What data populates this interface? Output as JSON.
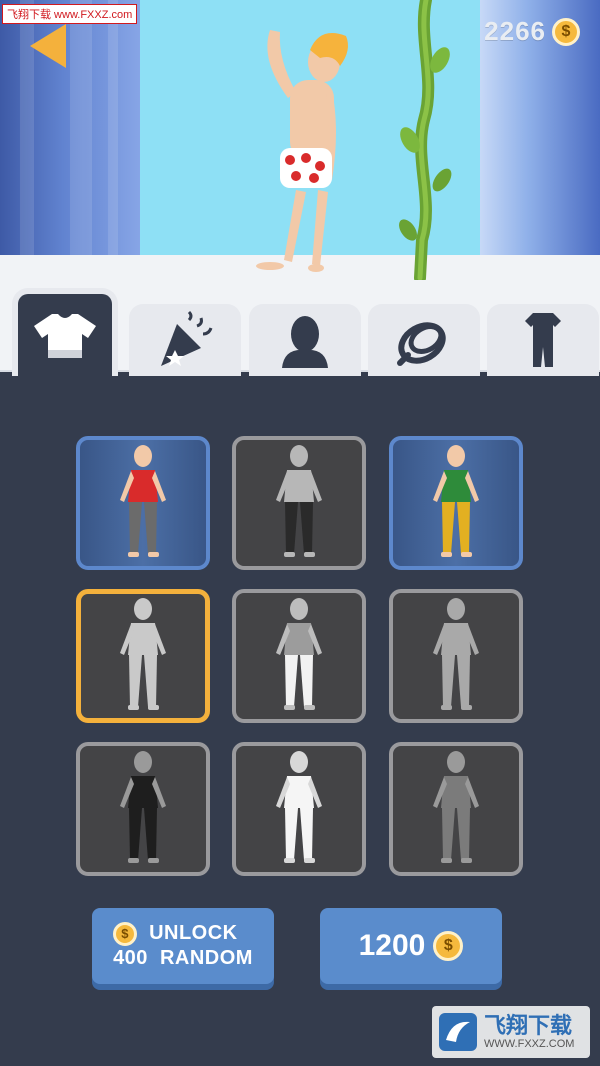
{
  "watermark_top": "飞翔下载 www.FXXZ.com",
  "coins": {
    "value": "2266",
    "icon": "coin-icon"
  },
  "back": {
    "icon": "back-arrow-icon",
    "color": "#f4b13c"
  },
  "tabs": [
    {
      "name": "outfits",
      "icon": "tshirt-icon",
      "active": true
    },
    {
      "name": "celebrations",
      "icon": "party-popper-icon",
      "active": false
    },
    {
      "name": "heads",
      "icon": "head-silhouette-icon",
      "active": false
    },
    {
      "name": "ropes",
      "icon": "rope-icon",
      "active": false
    },
    {
      "name": "suits",
      "icon": "tracksuit-icon",
      "active": false
    }
  ],
  "outfits": [
    {
      "state": "owned",
      "body": "#f2c9a8",
      "shirt": "#d92b2b",
      "pants": "#6b6b6b"
    },
    {
      "state": "locked",
      "body": "#b7b7b7",
      "shirt": "#b7b7b7",
      "pants": "#2a2a2a"
    },
    {
      "state": "owned",
      "body": "#f2c9a8",
      "shirt": "#2e8b3a",
      "pants": "#e3b021"
    },
    {
      "state": "selected",
      "body": "#c9c9c9",
      "shirt": "#c9c9c9",
      "pants": "#c9c9c9"
    },
    {
      "state": "locked",
      "body": "#bdbdbd",
      "shirt": "#9c9c9c",
      "pants": "#f2f2f2"
    },
    {
      "state": "locked",
      "body": "#a9a9a9",
      "shirt": "#a9a9a9",
      "pants": "#a9a9a9"
    },
    {
      "state": "locked",
      "body": "#9a9a9a",
      "shirt": "#1e1e1e",
      "pants": "#1e1e1e"
    },
    {
      "state": "locked",
      "body": "#d8d8d8",
      "shirt": "#f5f5f5",
      "pants": "#f5f5f5"
    },
    {
      "state": "locked",
      "body": "#9a9a9a",
      "shirt": "#7b7b7b",
      "pants": "#7b7b7b"
    }
  ],
  "unlock_button": {
    "line1": "UNLOCK",
    "cost": "400",
    "line2": "RANDOM",
    "icon": "coin-icon"
  },
  "price_button": {
    "value": "1200",
    "icon": "coin-icon"
  },
  "watermark_bottom": {
    "name": "飞翔下载",
    "url": "WWW.FXXZ.COM"
  }
}
